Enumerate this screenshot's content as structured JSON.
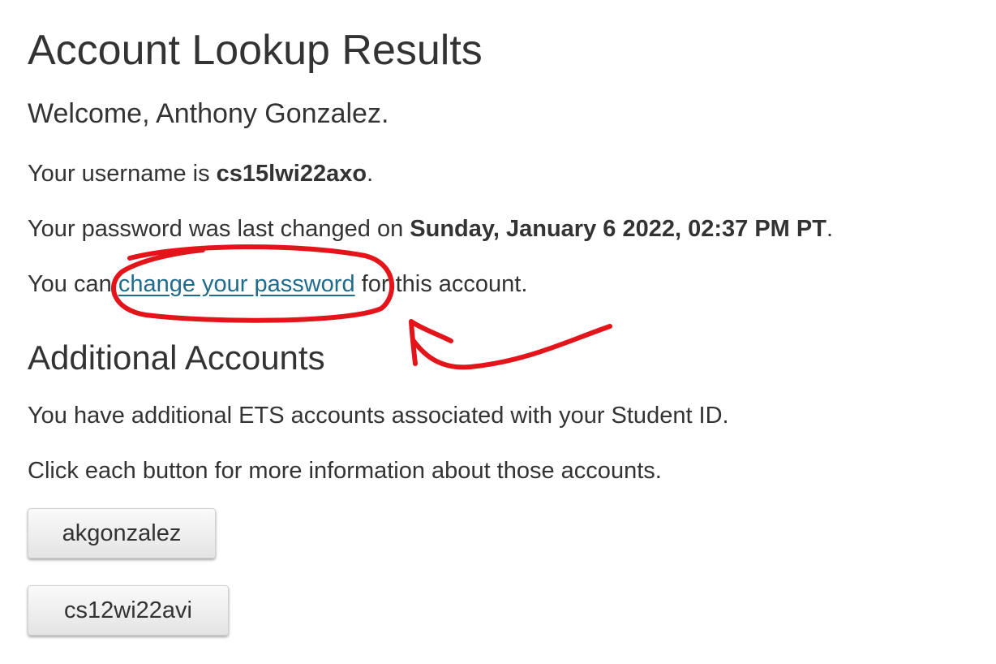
{
  "page": {
    "title": "Account Lookup Results",
    "welcome": "Welcome, Anthony Gonzalez."
  },
  "account": {
    "username_prefix": "Your username is ",
    "username": "cs15lwi22axo",
    "username_suffix": ".",
    "password_prefix": "Your password was last changed on ",
    "password_changed": "Sunday, January 6 2022, 02:37 PM PT",
    "password_suffix": ".",
    "change_prefix": "You can ",
    "change_link": "change your password",
    "change_suffix": " for this account."
  },
  "additional": {
    "heading": "Additional Accounts",
    "description": "You have additional ETS accounts associated with your Student ID.",
    "instruction": "Click each button for more information about those accounts.",
    "buttons": [
      "akgonzalez",
      "cs12wi22avi"
    ]
  },
  "annotation": {
    "color": "#e3151a"
  }
}
